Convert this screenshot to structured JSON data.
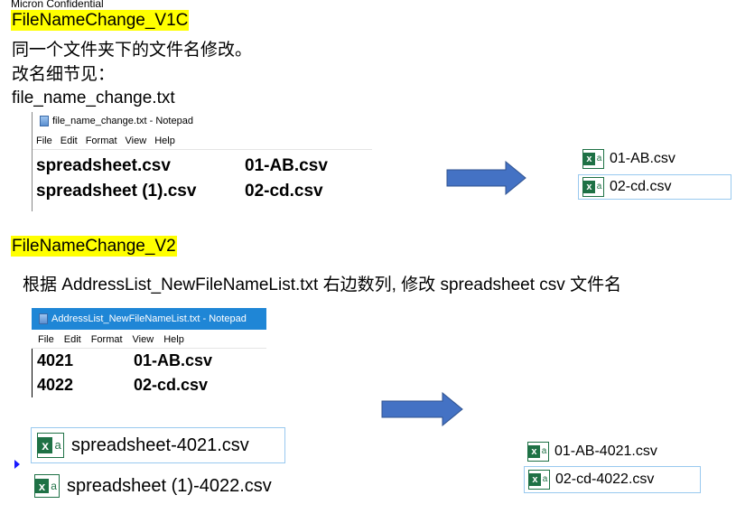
{
  "header": {
    "confidential": "Micron Confidential"
  },
  "v1": {
    "title": "FileNameChange_V1C",
    "desc1": "同一个文件夹下的文件名修改。",
    "desc2": "改名细节见：",
    "desc3": "file_name_change.txt",
    "notepad": {
      "title": "file_name_change.txt - Notepad",
      "menu": [
        "File",
        "Edit",
        "Format",
        "View",
        "Help"
      ],
      "rows": [
        {
          "left": "spreadsheet.csv",
          "right": "01-AB.csv"
        },
        {
          "left": "spreadsheet (1).csv",
          "right": "02-cd.csv"
        }
      ]
    },
    "results": [
      "01-AB.csv",
      "02-cd.csv"
    ]
  },
  "v2": {
    "title": "FileNameChange_V2",
    "desc": "根据 AddressList_NewFileNameList.txt 右边数列, 修改 spreadsheet csv 文件名",
    "notepad": {
      "title": "AddressList_NewFileNameList.txt - Notepad",
      "menu": [
        "File",
        "Edit",
        "Format",
        "View",
        "Help"
      ],
      "rows": [
        {
          "left": "4021",
          "right": "01-AB.csv"
        },
        {
          "left": "4022",
          "right": "02-cd.csv"
        }
      ]
    },
    "sources": [
      "spreadsheet-4021.csv",
      "spreadsheet (1)-4022.csv"
    ],
    "results": [
      "01-AB-4021.csv",
      "02-cd-4022.csv"
    ]
  },
  "colors": {
    "highlight": "#ffff00",
    "arrow": "#4472c4",
    "excel": "#1e7145",
    "titlebar": "#1f86d6"
  },
  "icons": [
    "notepad-icon",
    "excel-file-icon",
    "right-arrow-icon"
  ]
}
